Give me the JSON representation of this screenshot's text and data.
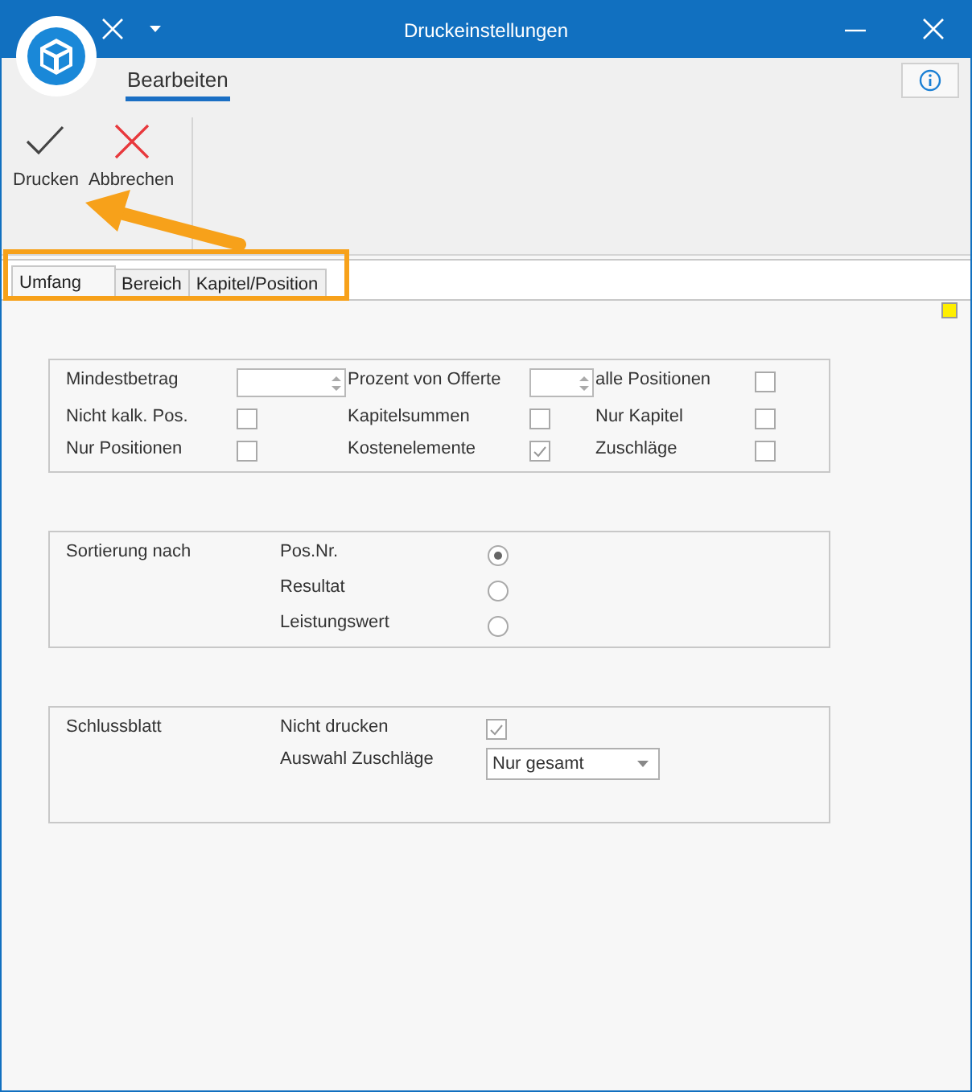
{
  "window": {
    "title": "Druckeinstellungen"
  },
  "ribbon": {
    "tabs": [
      {
        "label": "Bearbeiten",
        "selected": true
      }
    ],
    "buttons": [
      {
        "label": "Drucken",
        "kind": "check"
      },
      {
        "label": "Abbrechen",
        "kind": "cancel"
      }
    ]
  },
  "tabs": [
    {
      "label": "Umfang",
      "selected": true
    },
    {
      "label": "Bereich",
      "selected": false
    },
    {
      "label": "Kapitel/Position",
      "selected": false
    }
  ],
  "umfang": {
    "rows": [
      [
        {
          "label": "Mindestbetrag",
          "kind": "spin"
        },
        {
          "label": "Prozent von Offerte",
          "kind": "spin"
        },
        {
          "label": "alle Positionen",
          "kind": "check",
          "checked": false
        }
      ],
      [
        {
          "label": "Nicht kalk. Pos.",
          "kind": "check",
          "checked": false
        },
        {
          "label": "Kapitelsummen",
          "kind": "check",
          "checked": false
        },
        {
          "label": "Nur Kapitel",
          "kind": "check",
          "checked": false
        }
      ],
      [
        {
          "label": "Nur Positionen",
          "kind": "check",
          "checked": false
        },
        {
          "label": "Kostenelemente",
          "kind": "check",
          "checked": true
        },
        {
          "label": "Zuschläge",
          "kind": "check",
          "checked": false
        }
      ]
    ]
  },
  "sortierung": {
    "label": "Sortierung nach",
    "options": [
      {
        "label": "Pos.Nr.",
        "selected": true
      },
      {
        "label": "Resultat",
        "selected": false
      },
      {
        "label": "Leistungswert",
        "selected": false
      }
    ]
  },
  "schlussblatt": {
    "label": "Schlussblatt",
    "nicht_drucken": {
      "label": "Nicht drucken",
      "checked": true
    },
    "auswahl": {
      "label": "Auswahl Zuschläge",
      "value": "Nur gesamt"
    }
  }
}
